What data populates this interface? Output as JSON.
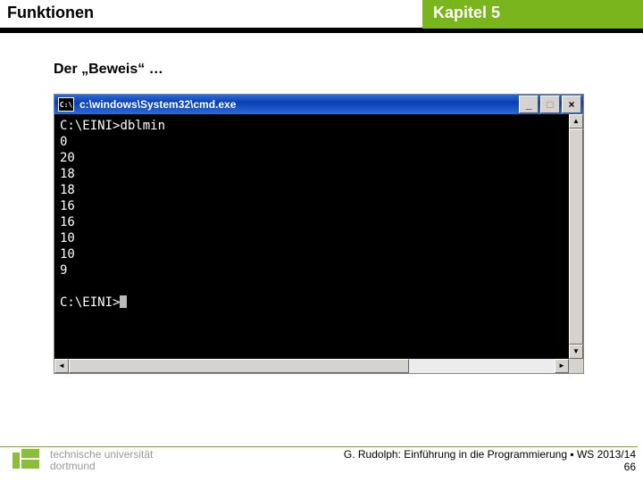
{
  "header": {
    "left": "Funktionen",
    "right": "Kapitel 5"
  },
  "subtitle": "Der „Beweis“ …",
  "cmd": {
    "icon_label": "C:\\",
    "title": "c:\\windows\\System32\\cmd.exe",
    "buttons": {
      "min": "_",
      "max": "□",
      "close": "×"
    },
    "prompt1": "C:\\EINI>",
    "command": "dblmin",
    "output": [
      "0",
      "20",
      "18",
      "18",
      "16",
      "16",
      "10",
      "10",
      "9"
    ],
    "prompt2": "C:\\EINI>",
    "scroll": {
      "up": "▲",
      "down": "▼",
      "left": "◄",
      "right": "►"
    }
  },
  "footer": {
    "uni_line1": "technische universität",
    "uni_line2": "dortmund",
    "credit": "G. Rudolph: Einführung in die Programmierung ▪ WS 2013/14",
    "page": "66"
  }
}
